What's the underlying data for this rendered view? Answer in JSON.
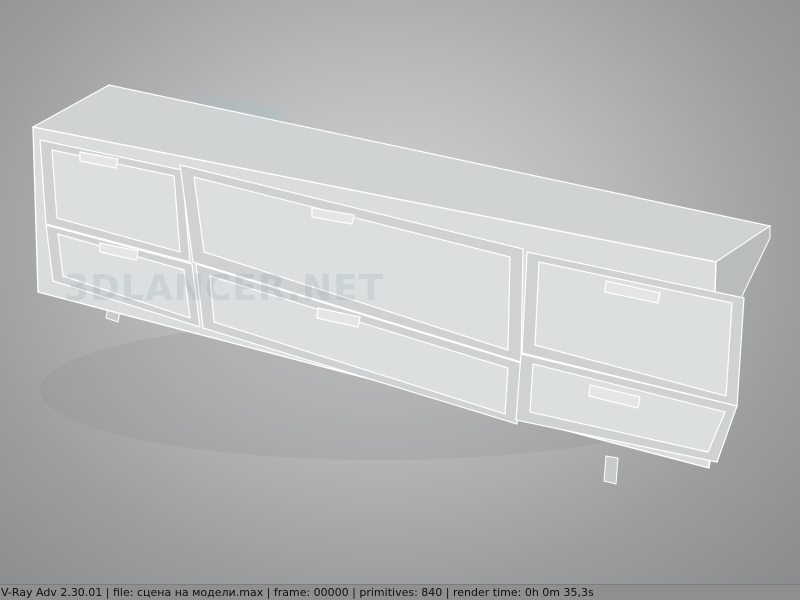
{
  "render": {
    "status_text": "V-Ray Adv 2.30.01 | file: сцена на модели.max | frame: 00000 | primitives: 840 | render time:  0h  0m 35,3s"
  },
  "watermark": {
    "text": "3DLANCER.NET",
    "logo_text": "3D"
  },
  "colors": {
    "background": "#a9aaab",
    "cabinet_body": "#d9dcdd",
    "cabinet_top": "#d2d5d6",
    "wireframe": "#ffffff",
    "status_bar": "#8f8f8f"
  }
}
